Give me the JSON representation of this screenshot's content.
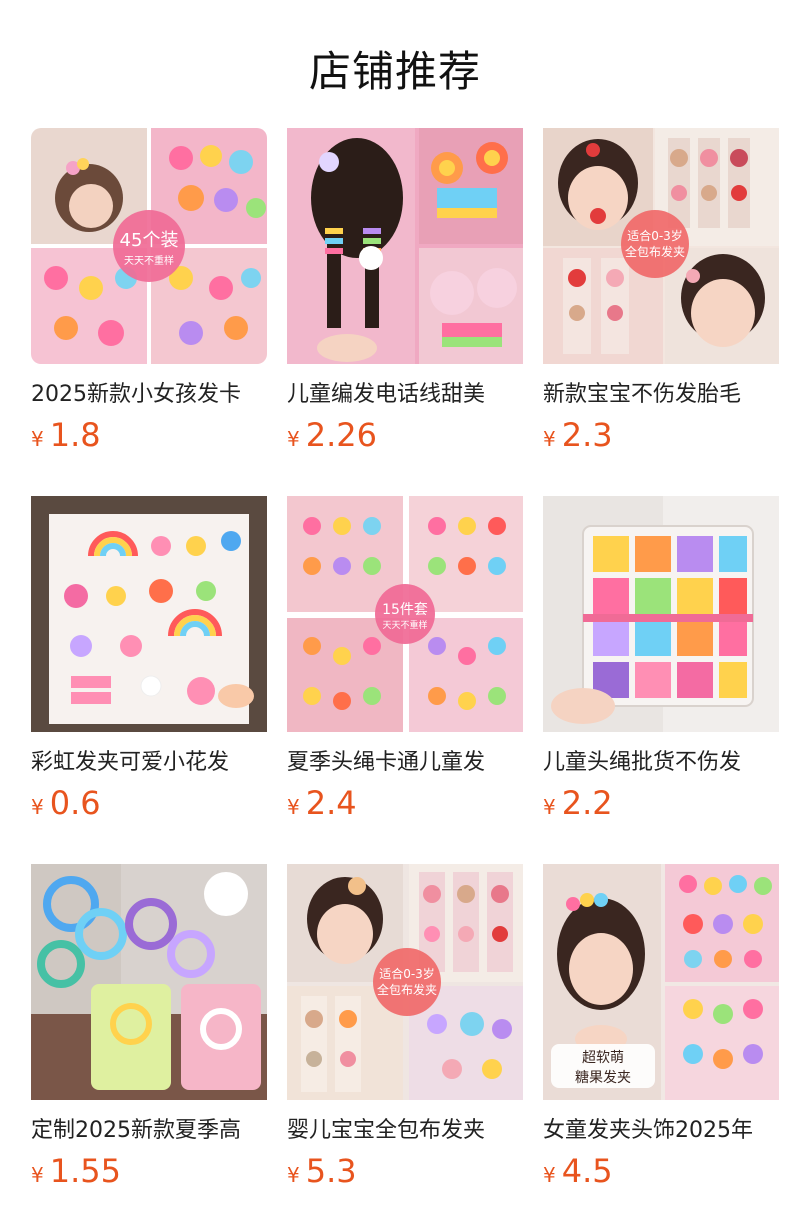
{
  "header": {
    "title": "店铺推荐"
  },
  "products": [
    {
      "name": "2025新款小女孩发卡",
      "currency": "¥",
      "price": "1.8",
      "image": "kids-hairclips-collage-image",
      "badge": [
        "45个装",
        "天天不重样"
      ]
    },
    {
      "name": "儿童编发电话线甜美",
      "currency": "¥",
      "price": "2.26",
      "image": "braided-phone-cord-hairtie-image",
      "badge": []
    },
    {
      "name": "新款宝宝不伤发胎毛",
      "currency": "¥",
      "price": "2.3",
      "image": "baby-hairclip-photo-image",
      "badge": [
        "适合0-3岁",
        "全包布发夹"
      ]
    },
    {
      "name": "彩虹发夹可爱小花发",
      "currency": "¥",
      "price": "0.6",
      "image": "rainbow-hairclips-card-image",
      "badge": []
    },
    {
      "name": "夏季头绳卡通儿童发",
      "currency": "¥",
      "price": "2.4",
      "image": "cartoon-hairties-collage-image",
      "badge": [
        "15件套",
        "天天不重样"
      ]
    },
    {
      "name": "儿童头绳批货不伤发",
      "currency": "¥",
      "price": "2.2",
      "image": "hairtie-storage-box-image",
      "badge": []
    },
    {
      "name": "定制2025新款夏季高",
      "currency": "¥",
      "price": "1.55",
      "image": "spiral-phone-cord-hairties-image",
      "badge": []
    },
    {
      "name": "婴儿宝宝全包布发夹",
      "currency": "¥",
      "price": "5.3",
      "image": "baby-fabric-hairclips-image",
      "badge": [
        "适合0-3岁",
        "全包布发夹"
      ]
    },
    {
      "name": "女童发夹头饰2025年",
      "currency": "¥",
      "price": "4.5",
      "image": "girls-hair-accessories-image",
      "badge": [
        "超软萌",
        "糖果发夹"
      ]
    }
  ],
  "colors": {
    "price": "#e8541e",
    "title": "#111111",
    "name": "#222222"
  }
}
